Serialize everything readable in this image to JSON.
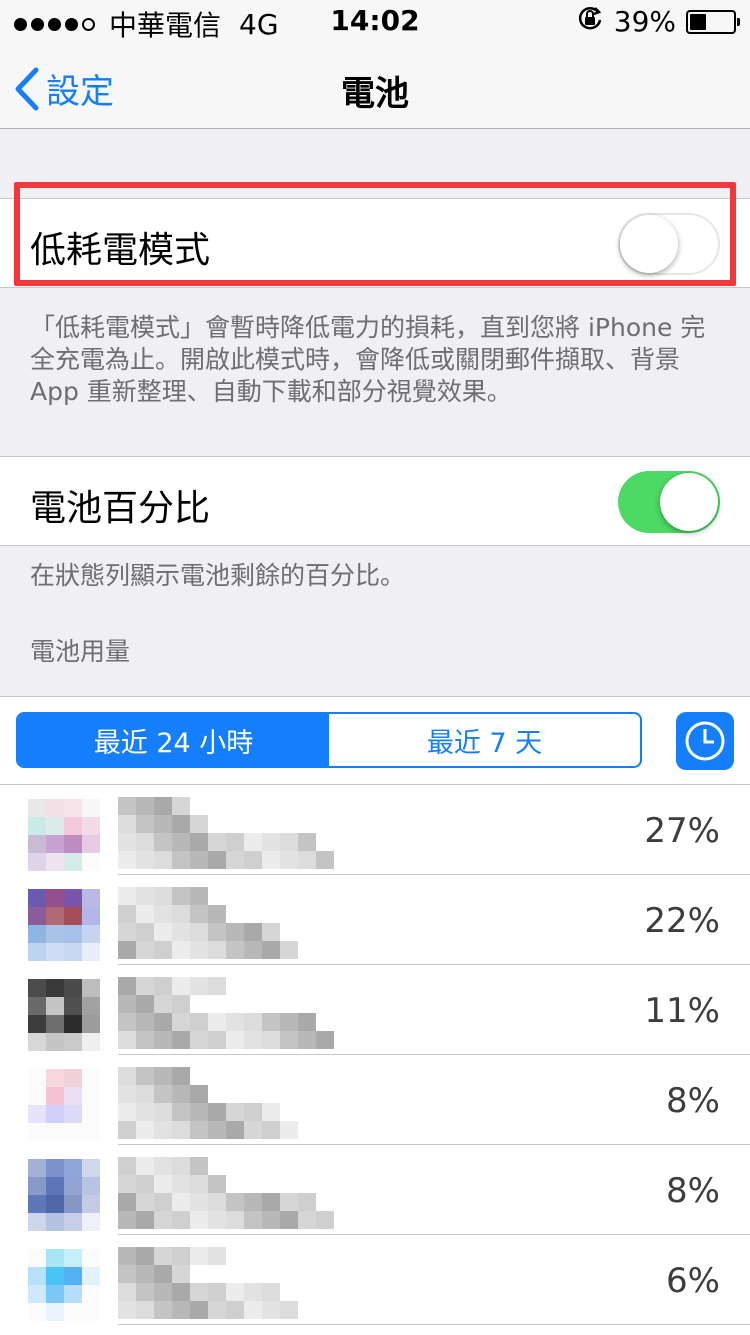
{
  "status_bar": {
    "carrier": "中華電信",
    "network": "4G",
    "time": "14:02",
    "battery_percent": "39%",
    "battery_level": 0.39
  },
  "nav": {
    "back_label": "設定",
    "title": "電池"
  },
  "low_power": {
    "label": "低耗電模式",
    "enabled": false,
    "footer": "「低耗電模式」會暫時降低電力的損耗，直到您將 iPhone 完全充電為止。開啟此模式時，會降低或關閉郵件擷取、背景 App 重新整理、自動下載和部分視覺效果。"
  },
  "battery_percentage": {
    "label": "電池百分比",
    "enabled": true,
    "footer": "在狀態列顯示電池剩餘的百分比。"
  },
  "usage": {
    "header": "電池用量",
    "segments": [
      "最近 24 小時",
      "最近 7 天"
    ],
    "selected_segment": 0,
    "apps": [
      {
        "percent": "27%",
        "icon_colors": [
          "#e8e8e8",
          "#f3dfe6",
          "#f6e3ea",
          "#f7f7f7",
          "#c8ebe5",
          "#dcecea",
          "#f3c9d9",
          "#f2dbe5",
          "#c7bcd4",
          "#c8a3d2",
          "#be8bc4",
          "#e7cbe4",
          "#ded3e8",
          "#ece5ef",
          "#d5ebe8",
          "#fbfbfb"
        ]
      },
      {
        "percent": "22%",
        "icon_colors": [
          "#6a5ab0",
          "#954f8f",
          "#7a55ab",
          "#b9b9e3",
          "#8a5c9b",
          "#b16a73",
          "#a54e57",
          "#b4b5e8",
          "#8fb6e2",
          "#a9c3e6",
          "#a6c0e7",
          "#c5d4f1",
          "#bcd4f0",
          "#cfdcf3",
          "#c8d8f3",
          "#e8eef8"
        ]
      },
      {
        "percent": "11%",
        "icon_colors": [
          "#4c4c4c",
          "#3a3a3a",
          "#4a4a4a",
          "#bdbdbd",
          "#6a6a6a",
          "#c5c5c5",
          "#505050",
          "#a2a2a2",
          "#3d3d3d",
          "#6e6e6e",
          "#2b2b2b",
          "#9c9c9c",
          "#d7d7d7",
          "#c5c5c5",
          "#cacaca",
          "#efefef"
        ]
      },
      {
        "percent": "8%",
        "icon_colors": [
          "#fbfbfb",
          "#f6d7de",
          "#f2d0d9",
          "#fbfbfb",
          "#fbfbfb",
          "#f4c2d3",
          "#e9dff2",
          "#fbfbfb",
          "#e6e3fb",
          "#cfd0fa",
          "#dcdaf6",
          "#fbfbfb",
          "#fbfbfb",
          "#fbfbfb",
          "#fbfbfb",
          "#fbfbfb"
        ]
      },
      {
        "percent": "8%",
        "icon_colors": [
          "#a4b1d6",
          "#7b92cc",
          "#8fa6d9",
          "#d0d6ec",
          "#8a99c8",
          "#5d76b9",
          "#91a3d2",
          "#b8c4e2",
          "#5d77b8",
          "#4e68a9",
          "#8597c6",
          "#c4cbe4",
          "#cdd6eb",
          "#b5c1e0",
          "#c6cfe7",
          "#eef1f8"
        ]
      },
      {
        "percent": "6%",
        "icon_colors": [
          "#fbfbfb",
          "#a6e5f8",
          "#c6eefb",
          "#fbfbfb",
          "#b7e1f9",
          "#4cc3f6",
          "#52b2f4",
          "#e2f2fd",
          "#cfe8fb",
          "#7bc7f8",
          "#b6ddfb",
          "#fbfbfb",
          "#fbfbfb",
          "#e8f3fd",
          "#fbfbfb",
          "#fbfbfb"
        ]
      }
    ]
  }
}
